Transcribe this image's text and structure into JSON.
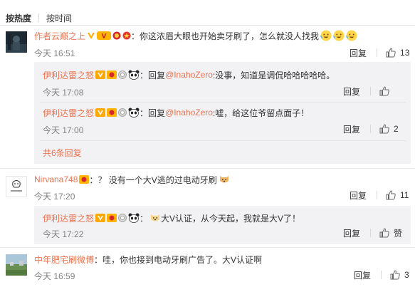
{
  "sort": {
    "hot": "按热度",
    "time": "按时间"
  },
  "actions": {
    "reply": "回复"
  },
  "colors": {
    "name": "#eb7350",
    "accent": "#ff8200",
    "vip": "#ffa800"
  },
  "comments": [
    {
      "user": "作者云巅之上",
      "colon": "：",
      "text": "你这浓眉大眼也开始卖牙刷了，怎么就没人找我",
      "time": "今天 16:51",
      "likes": "13",
      "replies": [
        {
          "user": "伊利达雷之怒",
          "prefix": "：回复",
          "mention": "@InahoZero",
          "text": ":没事，知道是调侃哈哈哈哈哈。",
          "time": "今天 17:08",
          "likes": ""
        },
        {
          "user": "伊利达雷之怒",
          "prefix": "：回复",
          "mention": "@InahoZero",
          "text": ":嘘，给这位爷留点面子！",
          "time": "今天 17:00",
          "likes": "2"
        }
      ],
      "more": "共6条回复"
    },
    {
      "user": "Nirvana748",
      "colon": "：",
      "text": "？ 没有一个大V逃的过电动牙刷",
      "time": "今天 17:20",
      "likes": "11",
      "replies": [
        {
          "user": "伊利达雷之怒",
          "prefix": "：",
          "text": "大V认证，从今天起，我就是大V了！",
          "time": "今天 17:22",
          "likes": "赞"
        }
      ]
    },
    {
      "user": "中年肥宅刷微博",
      "colon": "：",
      "text": "哇，你也接到电动牙刷广告了。大V认证啊",
      "time": "今天 16:59",
      "likes": "3"
    }
  ]
}
